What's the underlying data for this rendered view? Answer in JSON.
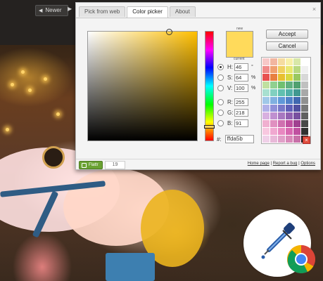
{
  "nav": {
    "newer_label": "Newer"
  },
  "tabs": [
    {
      "label": "Pick from web"
    },
    {
      "label": "Color picker"
    },
    {
      "label": "About"
    }
  ],
  "active_tab": "Color picker",
  "preview": {
    "new_label": "new",
    "current_label": "current",
    "new_color": "#ffda5b"
  },
  "fields": {
    "h": {
      "label": "H:",
      "value": "46",
      "unit": "°"
    },
    "s": {
      "label": "S:",
      "value": "64",
      "unit": "%"
    },
    "v": {
      "label": "V:",
      "value": "100",
      "unit": "%"
    },
    "r": {
      "label": "R:",
      "value": "255"
    },
    "g": {
      "label": "G:",
      "value": "218"
    },
    "b": {
      "label": "B:",
      "value": "91"
    }
  },
  "hex": {
    "label": "#:",
    "value": "ffda5b"
  },
  "buttons": {
    "accept": "Accept",
    "cancel": "Cancel"
  },
  "swatches": [
    "#f7c8c8",
    "#f2b6a0",
    "#f5dca0",
    "#f7f0a8",
    "#d8e8a8",
    "#ffffff",
    "#f08a8a",
    "#f0a070",
    "#f0d060",
    "#e8e870",
    "#b8d880",
    "#f0f0f0",
    "#e85050",
    "#e88040",
    "#e8c030",
    "#d8d840",
    "#98c860",
    "#d8d8d8",
    "#c0e0a0",
    "#90d090",
    "#70c070",
    "#60b080",
    "#50a070",
    "#c0c0c0",
    "#a8e0d0",
    "#80d0c0",
    "#60c0b0",
    "#50b0a8",
    "#409890",
    "#a8a8a8",
    "#a0c8e8",
    "#80b0e0",
    "#6098d8",
    "#5080c8",
    "#4068b0",
    "#909090",
    "#b0b0e8",
    "#9090d8",
    "#7878c8",
    "#6060b8",
    "#5050a0",
    "#787878",
    "#d8b0e0",
    "#c090d0",
    "#a878c0",
    "#9060b0",
    "#7850a0",
    "#606060",
    "#f0b0d0",
    "#e090c0",
    "#d070b0",
    "#c050a0",
    "#a04090",
    "#484848",
    "#f8c8e0",
    "#f0a8d0",
    "#e888c0",
    "#d868b0",
    "#c050a0",
    "#303030",
    "#f0d0e8",
    "#e8b8d8",
    "#e0a0c8",
    "#d888b8",
    "#c870a8",
    "#181818"
  ],
  "footer": {
    "flattr_label": "Flattr",
    "flattr_count": "19",
    "home_page": "Home page",
    "separator1": "|",
    "report_bug": "Report a bug",
    "separator2": "|",
    "options": "Options"
  }
}
